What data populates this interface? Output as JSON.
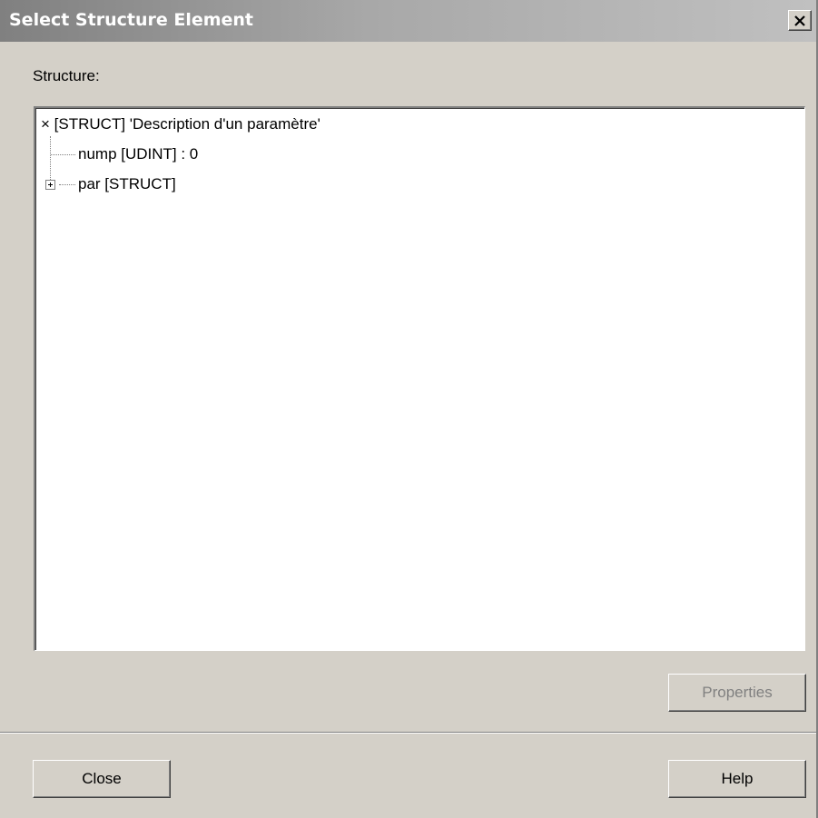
{
  "window": {
    "title": "Select Structure Element",
    "close_icon": "close-x-icon"
  },
  "structure_label": "Structure:",
  "tree": {
    "root": {
      "icon": "x-mark",
      "label": "[STRUCT] 'Description d'un paramètre'"
    },
    "children": [
      {
        "label": "nump [UDINT] :  0",
        "expandable": false
      },
      {
        "label": "par [STRUCT]",
        "expandable": true,
        "expander_icon": "plus-box-icon"
      }
    ]
  },
  "buttons": {
    "properties": {
      "label": "Properties",
      "enabled": false
    },
    "close": {
      "label": "Close"
    },
    "help": {
      "label": "Help"
    }
  }
}
